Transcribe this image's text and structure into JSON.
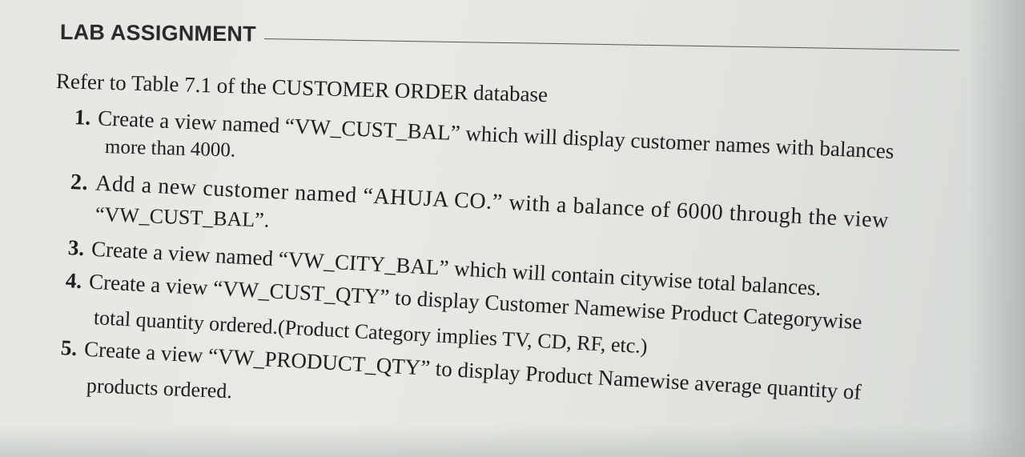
{
  "heading": "LAB ASSIGNMENT",
  "intro": "Refer to Table 7.1 of the CUSTOMER ORDER database",
  "items": [
    {
      "number": "1.",
      "line1": "Create a view named “VW_CUST_BAL” which will display customer names with balances",
      "line2": "more than 4000."
    },
    {
      "number": "2.",
      "line1": "Add a new customer named “AHUJA CO.” with a balance of 6000 through the view",
      "line2": "“VW_CUST_BAL”."
    },
    {
      "number": "3.",
      "line1": "Create a view named “VW_CITY_BAL” which will contain citywise total balances."
    },
    {
      "number": "4.",
      "line1": "Create a view “VW_CUST_QTY” to display Customer Namewise Product Categorywise",
      "line2": "total quantity ordered.(Product Category implies TV, CD, RF, etc.)"
    },
    {
      "number": "5.",
      "line1": "Create a view “VW_PRODUCT_QTY” to display Product Namewise average quantity of",
      "line2": "products ordered."
    }
  ]
}
